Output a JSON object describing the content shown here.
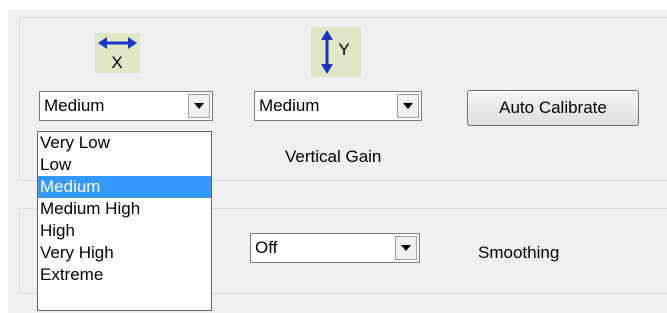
{
  "horizontal": {
    "icon": "horizontal-gain-arrows-icon",
    "axis_letter": "X",
    "selected": "Medium",
    "options": [
      "Very Low",
      "Low",
      "Medium",
      "Medium High",
      "High",
      "Very High",
      "Extreme"
    ]
  },
  "vertical": {
    "icon": "vertical-gain-arrows-icon",
    "axis_letter": "Y",
    "selected": "Medium",
    "label": "Vertical Gain"
  },
  "auto_calibrate": {
    "label": "Auto Calibrate"
  },
  "smoothing": {
    "selected": "Off",
    "label": "Smoothing"
  },
  "colors": {
    "panel_background": "#f0f0f0",
    "icon_background": "#dfe7c6",
    "arrow_blue": "#1f33c8",
    "selection_highlight": "#3399ff"
  }
}
